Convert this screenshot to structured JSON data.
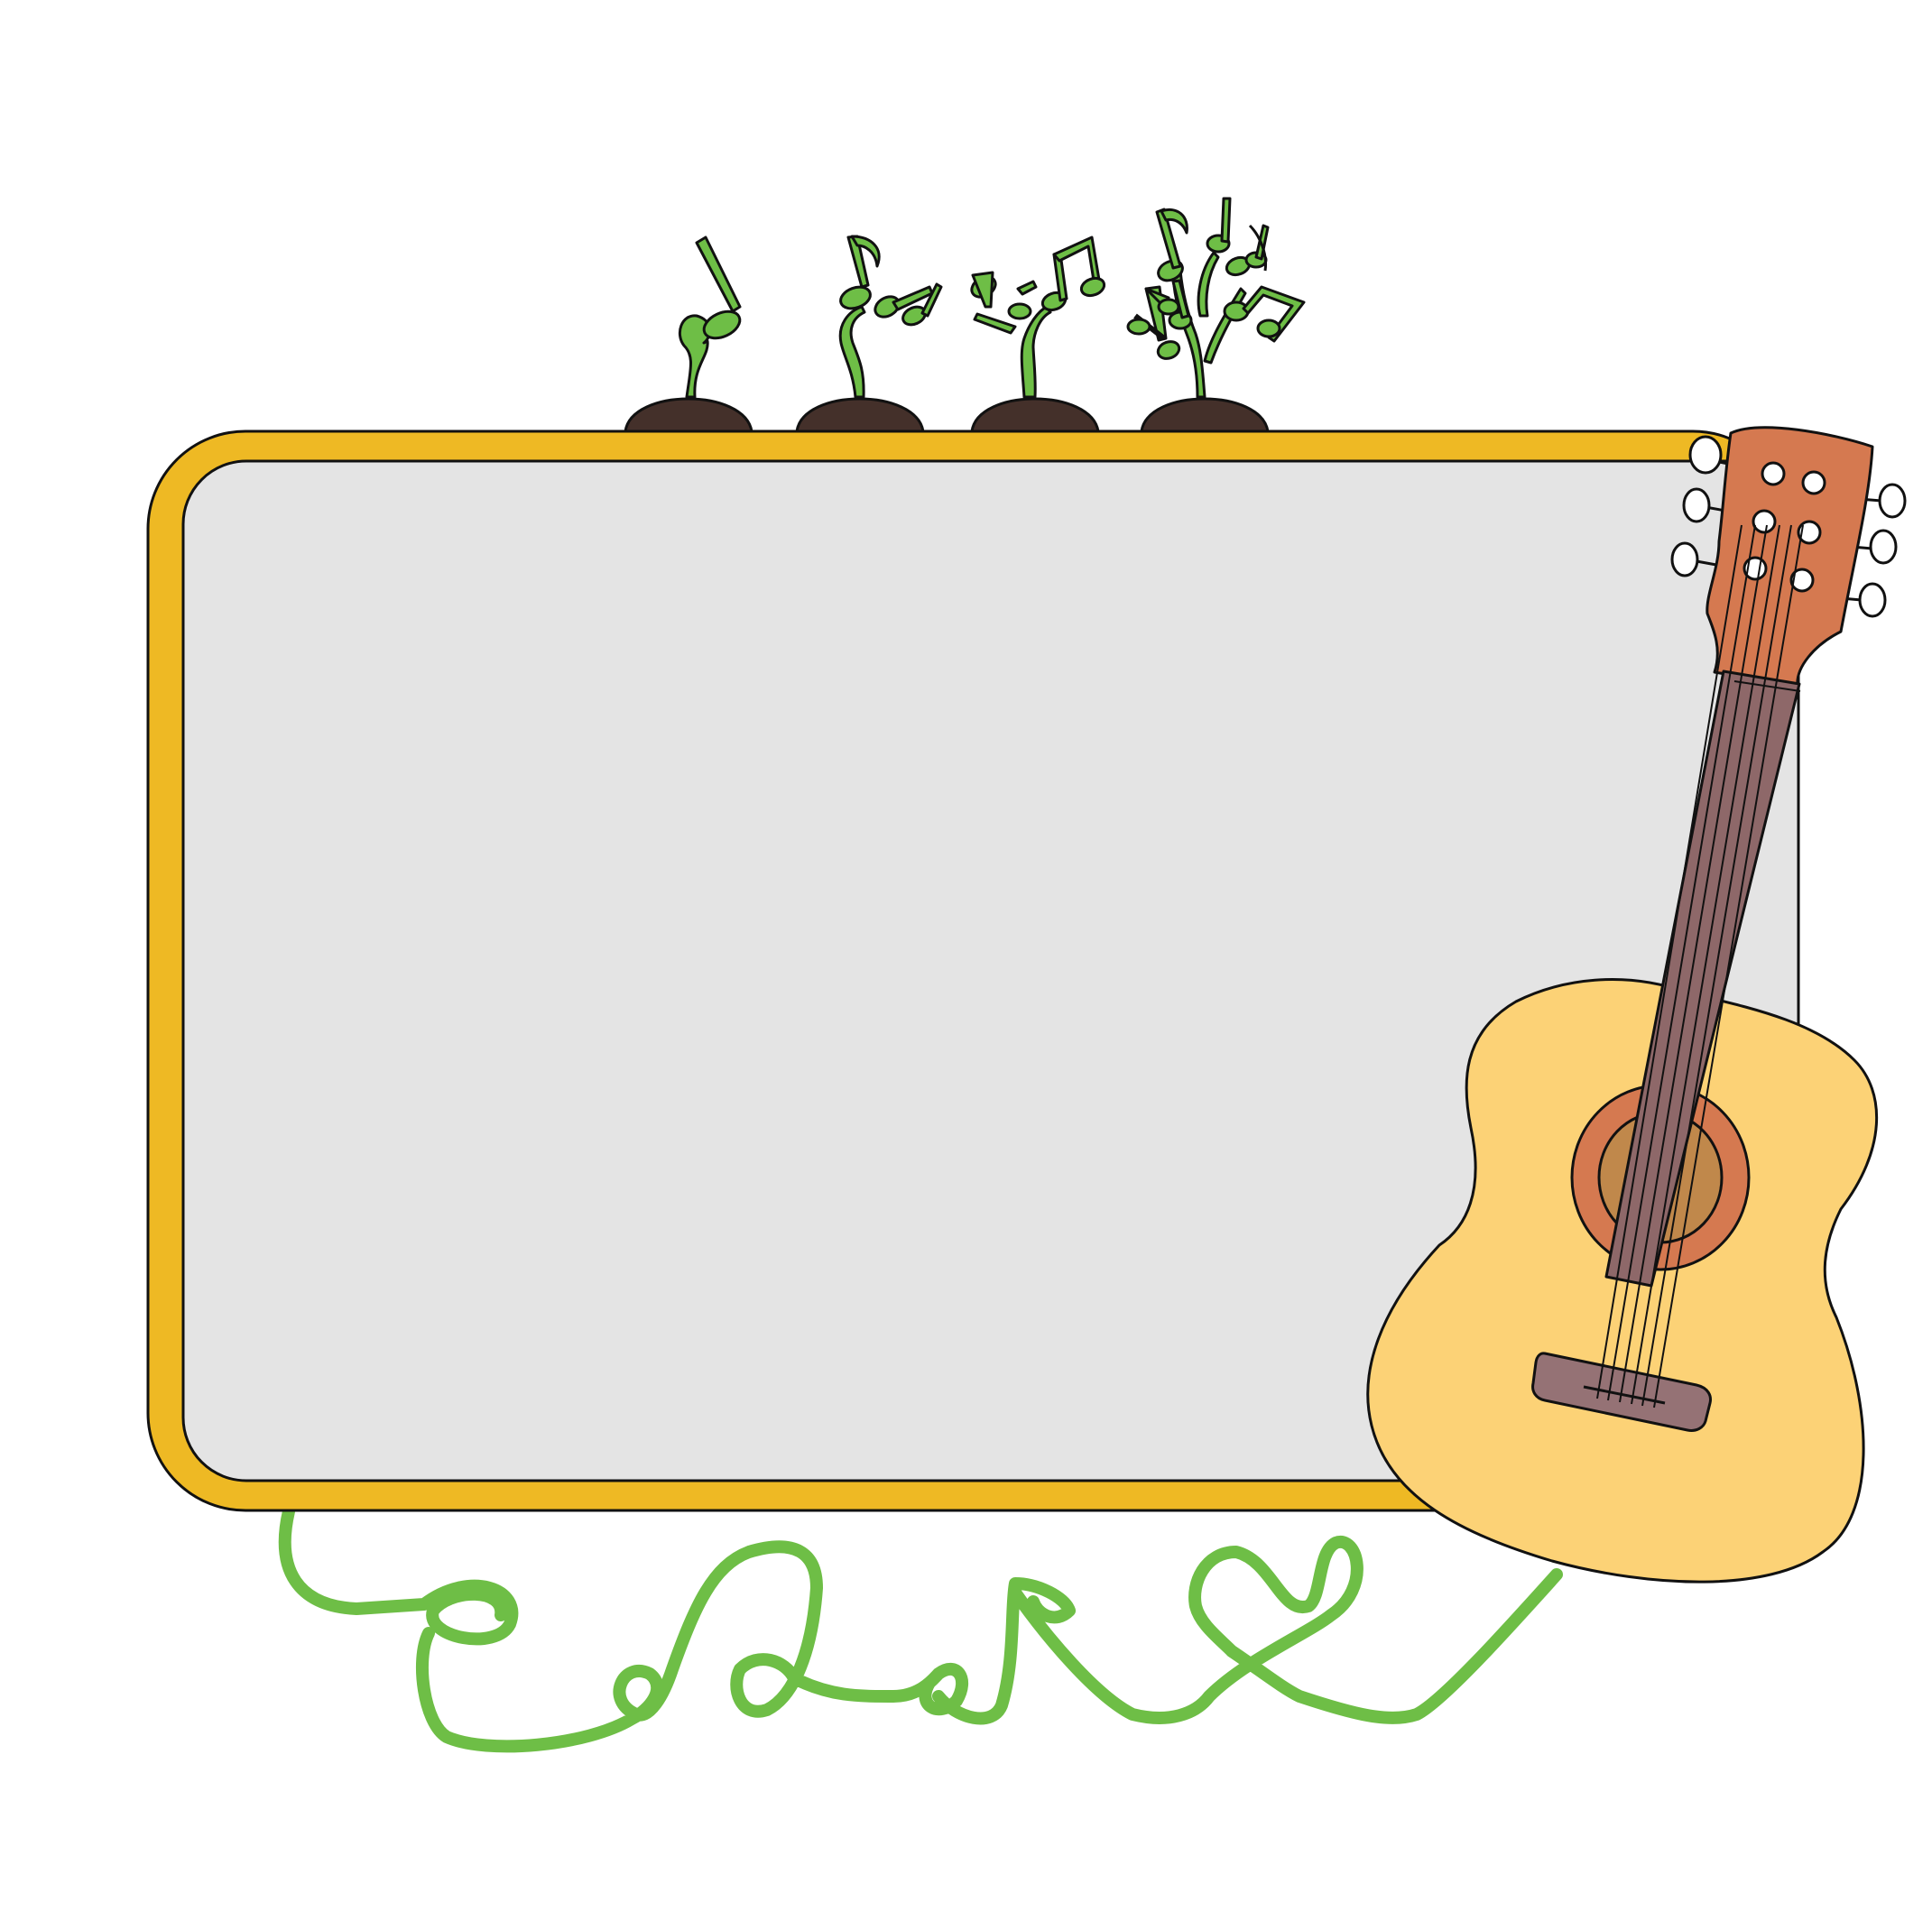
{
  "board": {
    "frame_color": "#EEB924",
    "surface_color": "#E4E4E4",
    "outline_color": "#111111",
    "text": ""
  },
  "sprouts": {
    "count": 4,
    "soil_color": "#44302A",
    "leaf_color": "#6EBE46",
    "icon": "music-note-sprout-icon"
  },
  "vine": {
    "color": "#6EBE46",
    "icon": "curly-vine"
  },
  "guitar": {
    "icon": "acoustic-guitar-icon",
    "body_color": "#FCD276",
    "head_color": "#D57950",
    "neck_color": "#8E6869",
    "rosette_color": "#D57950",
    "soundhole_color": "#C0884B",
    "bridge_color": "#957275"
  }
}
